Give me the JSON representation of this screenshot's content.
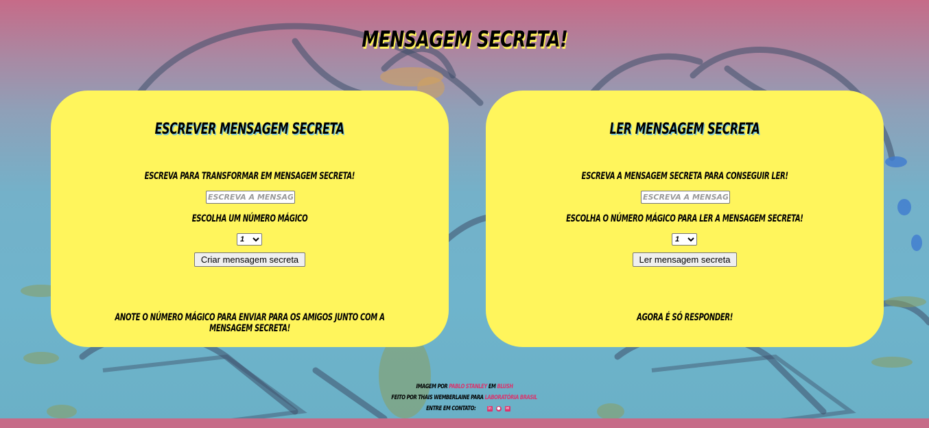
{
  "page": {
    "title": "Mensagem secreta!"
  },
  "encode_card": {
    "title": "Escrever mensagem secreta",
    "input_label": "Escreva para transformar em mensagem secreta!",
    "input_placeholder": "Escreva a mensagem",
    "number_label": "Escolha um número mágico",
    "number_selected": "1",
    "button_label": "Criar mensagem secreta",
    "note": "Anote o número mágico para enviar para os amigos junto com a mensagem secreta!"
  },
  "decode_card": {
    "title": "Ler mensagem secreta",
    "input_label": "Escreva a mensagem secreta para conseguir ler!",
    "input_placeholder": "Escreva a mensagem",
    "number_label": "Escolha o número mágico para ler a mensagem secreta!",
    "number_selected": "1",
    "button_label": "Ler mensagem secreta",
    "note": "Agora é só responder!"
  },
  "footer": {
    "image_prefix": "Imagem por",
    "image_author": "Pablo Stanley",
    "image_mid": "em",
    "image_source": "Blush",
    "made_prefix": "Feito por Thais Wemberlaine para",
    "made_org": "Laboratória Brasil",
    "contact_label": "Entre em contato:",
    "contact_icons": [
      "linkedin-icon",
      "github-icon",
      "email-icon"
    ]
  },
  "colors": {
    "card_bg": "#fff55c",
    "accent_pink": "#d8366e",
    "top_pink": "#c66b88",
    "bg_blue": "#6fb4cc"
  }
}
